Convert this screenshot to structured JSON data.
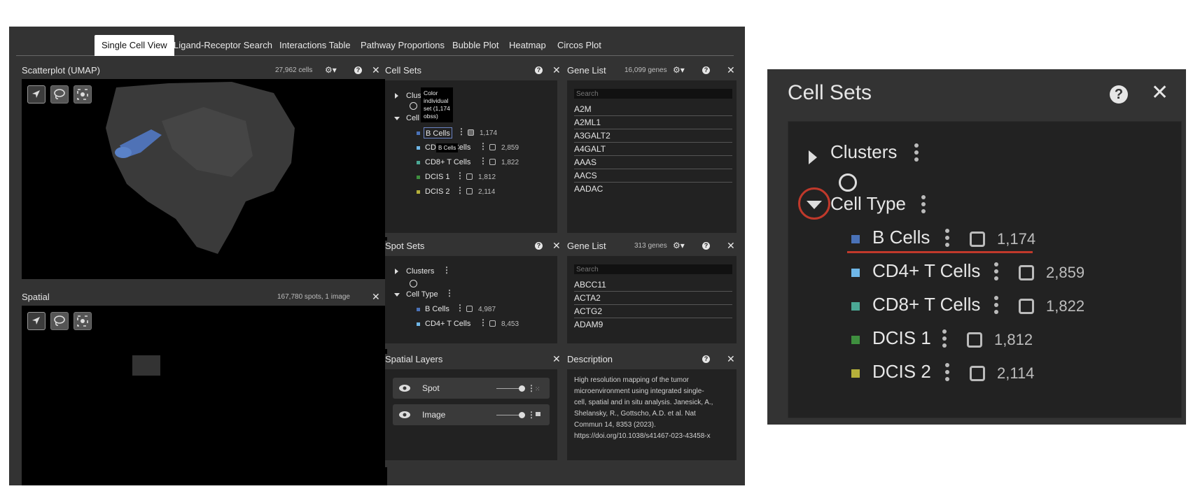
{
  "tabs": [
    "Single Cell View",
    "Ligand-Receptor Search",
    "Interactions Table",
    "Pathway Proportions",
    "Bubble Plot",
    "Heatmap",
    "Circos Plot"
  ],
  "scatterplot": {
    "title": "Scatterplot (UMAP)",
    "meta": "27,962 cells"
  },
  "spatial": {
    "title": "Spatial",
    "meta": "167,780 spots, 1 image"
  },
  "cell_sets": {
    "title": "Cell Sets",
    "clusters_label": "Clusters",
    "cell_type_label": "Cell Type",
    "items": [
      {
        "label": "B Cells",
        "count": "1,174",
        "color": "#4a72b8"
      },
      {
        "label": "CD4+ T Cells",
        "count": "2,859",
        "color": "#6fb7e8"
      },
      {
        "label": "CD8+ T Cells",
        "count": "1,822",
        "color": "#4ba895"
      },
      {
        "label": "DCIS 1",
        "count": "1,812",
        "color": "#3f8f3f"
      },
      {
        "label": "DCIS 2",
        "count": "2,114",
        "color": "#b5b03a"
      }
    ],
    "tooltip": "Color individual set (1,174 obss)",
    "hover_label": "B Cells"
  },
  "gene_list_1": {
    "title": "Gene List",
    "meta": "16,099 genes",
    "search_placeholder": "Search",
    "genes": [
      "A2M",
      "A2ML1",
      "A3GALT2",
      "A4GALT",
      "AAAS",
      "AACS",
      "AADAC"
    ]
  },
  "spot_sets": {
    "title": "Spot Sets",
    "clusters_label": "Clusters",
    "cell_type_label": "Cell Type",
    "items": [
      {
        "label": "B Cells",
        "count": "4,987",
        "color": "#4a72b8"
      },
      {
        "label": "CD4+ T Cells",
        "count": "8,453",
        "color": "#6fb7e8"
      }
    ]
  },
  "gene_list_2": {
    "title": "Gene List",
    "meta": "313 genes",
    "search_placeholder": "Search",
    "genes": [
      "ABCC11",
      "ACTA2",
      "ACTG2",
      "ADAM9"
    ]
  },
  "spatial_layers": {
    "title": "Spatial Layers",
    "layers": [
      {
        "label": "Spot"
      },
      {
        "label": "Image"
      }
    ]
  },
  "description": {
    "title": "Description",
    "lines": [
      "High resolution mapping of the tumor",
      "microenvironment using integrated single-",
      "cell, spatial and in situ analysis. Janesick, A.,",
      "Shelansky, R., Gottscho, A.D. et al. Nat",
      "Commun 14, 8353 (2023).",
      "https://doi.org/10.1038/s41467-023-43458-x"
    ]
  },
  "accent": "#c0392b"
}
